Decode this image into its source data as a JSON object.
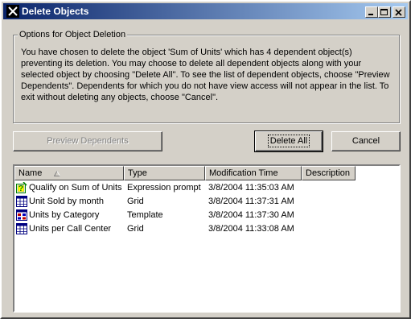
{
  "window": {
    "title": "Delete Objects"
  },
  "options": {
    "legend": "Options for Object Deletion",
    "message": "You have chosen to delete the object 'Sum of Units' which has 4 dependent object(s) preventing its deletion. You may choose to delete all dependent objects along with your selected object by choosing \"Delete All\". To see the list of dependent objects, choose \"Preview Dependents\". Dependents for which you do not have view access will not appear in the list. To exit without deleting any objects, choose \"Cancel\"."
  },
  "buttons": {
    "preview": "Preview Dependents",
    "delete_all": "Delete All",
    "cancel": "Cancel"
  },
  "table": {
    "columns": [
      "Name",
      "Type",
      "Modification Time",
      "Description"
    ],
    "rows": [
      {
        "icon": "prompt-icon",
        "name": "Qualify on Sum of Units",
        "type": "Expression prompt",
        "time": "3/8/2004 11:35:03 AM",
        "description": ""
      },
      {
        "icon": "grid-icon",
        "name": "Unit Sold by month",
        "type": "Grid",
        "time": "3/8/2004 11:37:31 AM",
        "description": ""
      },
      {
        "icon": "template-icon",
        "name": "Units by Category",
        "type": "Template",
        "time": "3/8/2004 11:37:30 AM",
        "description": ""
      },
      {
        "icon": "grid-icon",
        "name": "Units per Call Center",
        "type": "Grid",
        "time": "3/8/2004 11:33:08 AM",
        "description": ""
      }
    ]
  }
}
